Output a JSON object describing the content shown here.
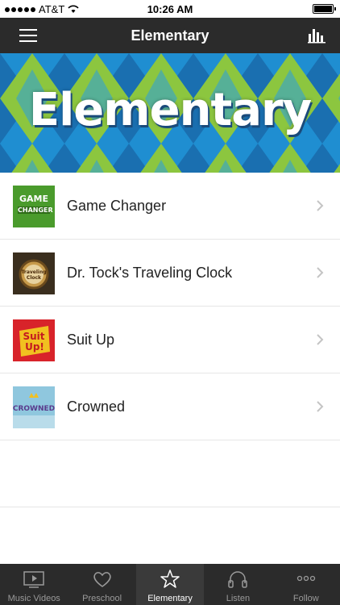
{
  "status_bar": {
    "carrier": "AT&T",
    "time": "10:26 AM"
  },
  "nav": {
    "title": "Elementary"
  },
  "banner": {
    "title": "Elementary"
  },
  "list": [
    {
      "label": "Game Changer",
      "thumb_text_top": "GAME",
      "thumb_text_bottom": "CHANGER"
    },
    {
      "label": "Dr. Tock's Traveling Clock",
      "thumb_text": "Traveling Clock"
    },
    {
      "label": "Suit Up",
      "thumb_text": "Suit Up!"
    },
    {
      "label": "Crowned",
      "thumb_text": "CROWNED"
    }
  ],
  "tabs": [
    {
      "label": "Music Videos",
      "icon": "play-icon"
    },
    {
      "label": "Preschool",
      "icon": "heart-icon"
    },
    {
      "label": "Elementary",
      "icon": "star-icon",
      "active": true
    },
    {
      "label": "Listen",
      "icon": "headphones-icon"
    },
    {
      "label": "Follow",
      "icon": "more-icon"
    }
  ],
  "colors": {
    "nav_bg": "#2b2b2b",
    "banner_blue": "#1f8ed1",
    "banner_green": "#8cc63f"
  }
}
